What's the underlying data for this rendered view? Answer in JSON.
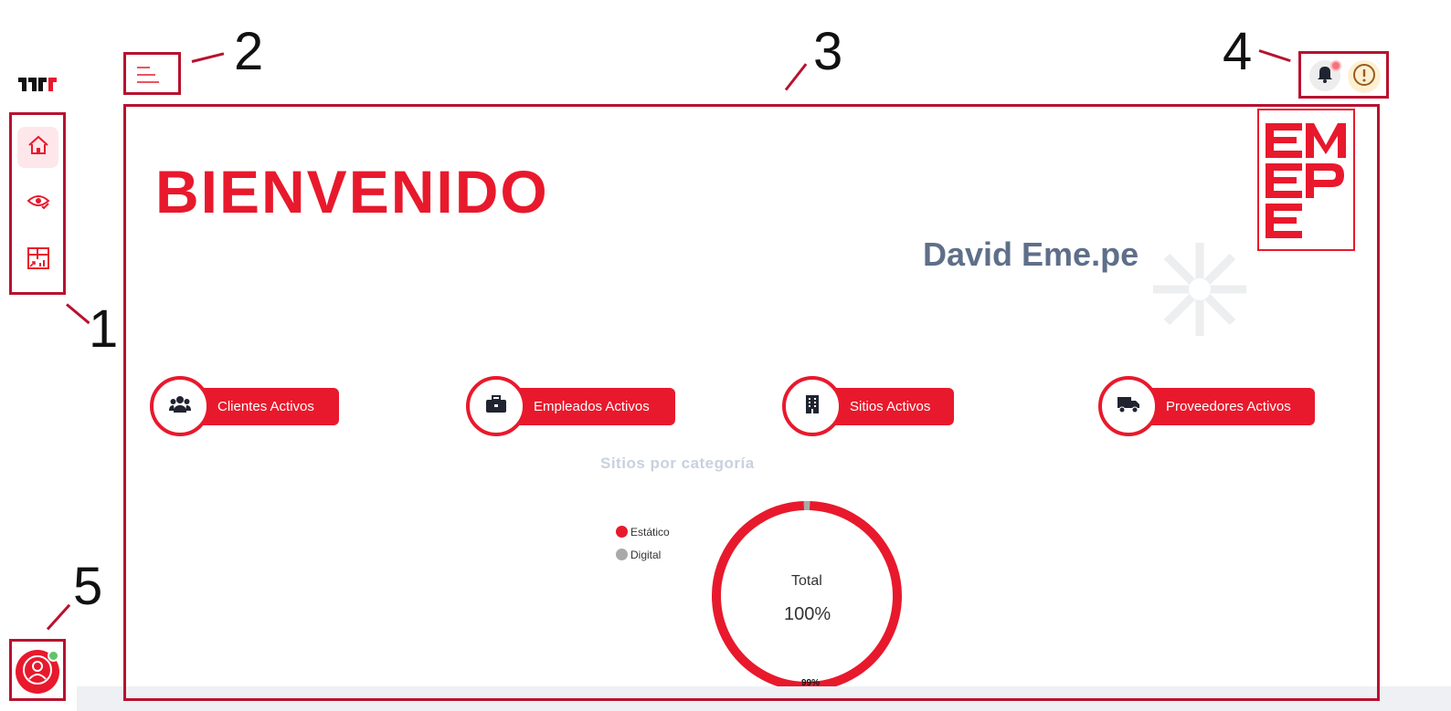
{
  "app": {
    "logo_text": "ƎMƎ",
    "brand_mark": "EM EP E"
  },
  "sidebar": {
    "items": [
      {
        "icon": "home-icon",
        "label": "Inicio",
        "active": true
      },
      {
        "icon": "eye-check-icon",
        "label": "Monitoreo",
        "active": false
      },
      {
        "icon": "dashboard-chart-icon",
        "label": "Reportes",
        "active": false
      }
    ]
  },
  "header": {
    "menu_icon": "hamburger-menu-icon",
    "notification_icon": "bell-icon",
    "info_icon": "alert-circle-icon"
  },
  "main": {
    "welcome": "BIENVENIDO",
    "user_name": "David Eme.pe",
    "stats": [
      {
        "label": "Clientes Activos",
        "icon": "users-icon"
      },
      {
        "label": "Empleados Activos",
        "icon": "briefcase-icon"
      },
      {
        "label": "Sitios Activos",
        "icon": "building-icon"
      },
      {
        "label": "Proveedores Activos",
        "icon": "truck-icon"
      }
    ],
    "chart": {
      "title": "Sitios por categoría",
      "center_label": "Total",
      "center_value": "100%",
      "slice_label": "99%"
    }
  },
  "annotations": [
    "1",
    "2",
    "3",
    "4",
    "5"
  ],
  "colors": {
    "accent": "#e8192c",
    "annotation": "#b8122f",
    "muted_text": "#5f6f89",
    "digital": "#a9a9a9"
  },
  "chart_data": {
    "type": "pie",
    "title": "Sitios por categoría",
    "categories": [
      "Estático",
      "Digital"
    ],
    "values": [
      99,
      1
    ],
    "colors": [
      "#e8192c",
      "#a9a9a9"
    ],
    "legend": "left"
  }
}
